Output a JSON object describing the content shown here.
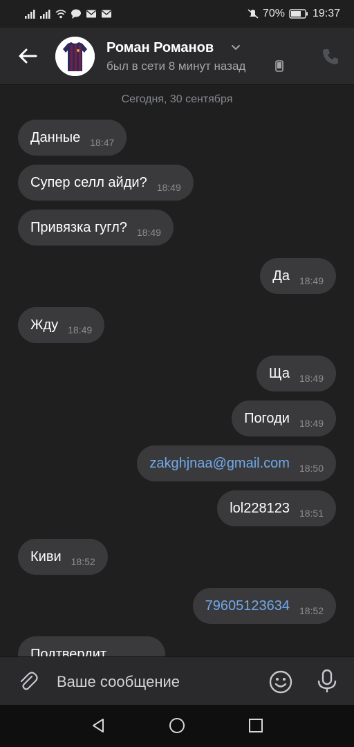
{
  "status_bar": {
    "battery": "70%",
    "time": "19:37",
    "icons": [
      "signal-icon",
      "signal-icon",
      "wifi-icon",
      "chat-bubble-icon",
      "mail-icon",
      "mail-icon",
      "mute-icon",
      "battery-icon"
    ]
  },
  "header": {
    "name": "Роман Романов",
    "status": "был в сети 8 минут назад",
    "icons": [
      "back-arrow-icon",
      "chevron-down-icon",
      "mobile-phone-icon",
      "call-icon"
    ]
  },
  "chat": {
    "date": "Сегодня, 30 сентября",
    "messages": [
      {
        "side": "in",
        "text": "Данные",
        "time": "18:47"
      },
      {
        "side": "in",
        "text": "Супер селл айди?",
        "time": "18:49"
      },
      {
        "side": "in",
        "text": "Привязка гугл?",
        "time": "18:49"
      },
      {
        "side": "out",
        "text": "Да",
        "time": "18:49"
      },
      {
        "side": "in",
        "text": "Жду",
        "time": "18:49"
      },
      {
        "side": "out",
        "text": "Ща",
        "time": "18:49"
      },
      {
        "side": "out",
        "text": "Погоди",
        "time": "18:49"
      },
      {
        "side": "out",
        "text": "zakghjnaa@gmail.com",
        "time": "18:50",
        "link": true
      },
      {
        "side": "out",
        "text": "lol228123",
        "time": "18:51"
      },
      {
        "side": "in",
        "text": "Киви",
        "time": "18:52"
      },
      {
        "side": "out",
        "text": "79605123634",
        "time": "18:52",
        "link": true
      },
      {
        "side": "in",
        "text": "Подтвердит",
        "time": ""
      }
    ]
  },
  "composer": {
    "placeholder": "Ваше сообщение",
    "icons": [
      "paperclip-icon",
      "emoji-icon",
      "microphone-icon"
    ]
  },
  "nav": {
    "icons": [
      "nav-back-icon",
      "nav-home-icon",
      "nav-recent-icon"
    ]
  },
  "colors": {
    "background": "#1f1f20",
    "header": "#2a2a2c",
    "bubble": "#3a3a3c",
    "link": "#71aaeb",
    "muted_text": "#a5a5a8"
  }
}
